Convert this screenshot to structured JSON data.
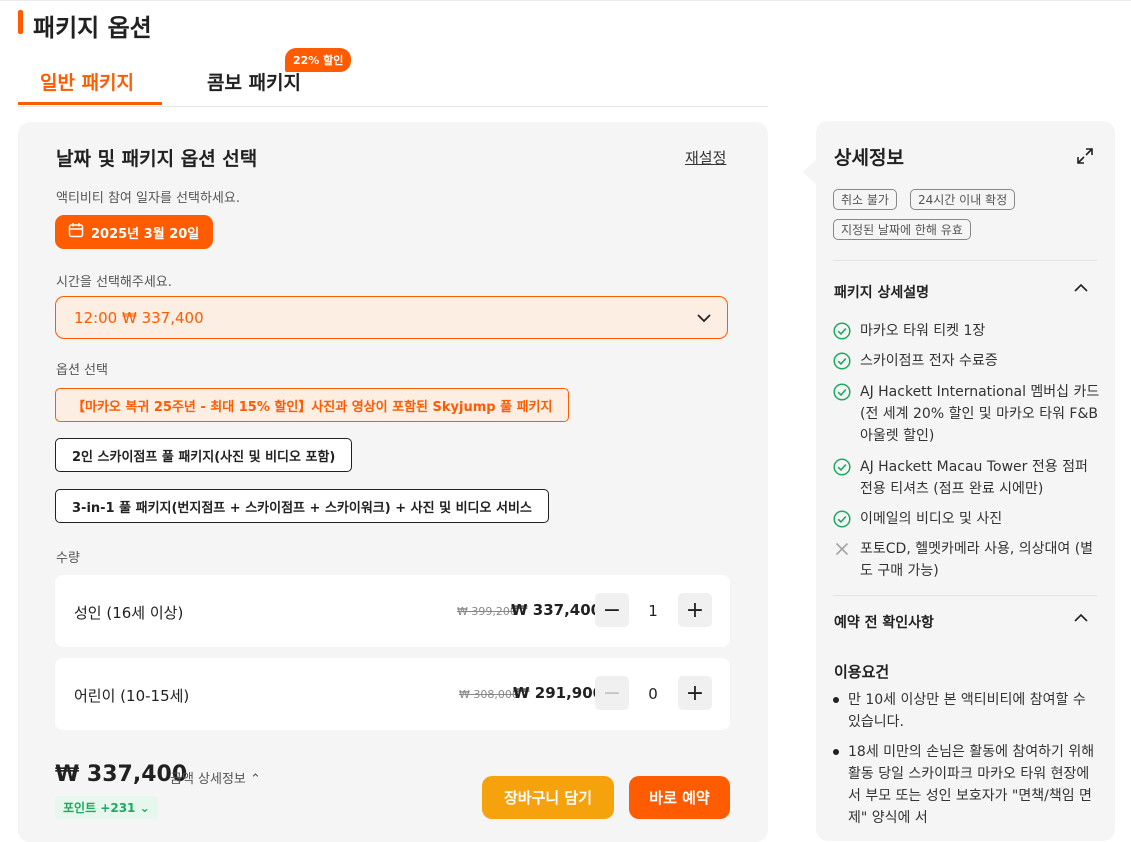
{
  "header": {
    "title": "패키지 옵션"
  },
  "tabs": [
    {
      "label": "일반 패키지",
      "active": true
    },
    {
      "label": "콤보 패키지",
      "badge": "22% 할인"
    }
  ],
  "booking": {
    "title": "날짜 및 패키지 옵션 선택",
    "reset_label": "재설정",
    "date_prompt": "액티비티 참여 일자를 선택하세요.",
    "date_value": "2025년 3월 20일",
    "time_prompt": "시간을 선택해주세요.",
    "time_value": "12:00 ₩ 337,400",
    "options_label": "옵션 선택",
    "options": [
      "【마카오 복귀 25주년 - 최대 15% 할인】사진과 영상이 포함된 Skyjump 풀 패키지",
      "2인 스카이점프 풀 패키지(사진 및 비디오 포함)",
      "3-in-1 풀 패키지(번지점프 + 스카이점프 + 스카이워크) + 사진 및 비디오 서비스"
    ],
    "selected_option_index": 0,
    "quantity_label": "수량",
    "quantities": [
      {
        "label": "성인 (16세 이상)",
        "original_price": "₩ 399,200",
        "price": "₩ 337,400",
        "count": "1",
        "minus_enabled": true
      },
      {
        "label": "어린이 (10-15세)",
        "original_price": "₩ 308,000",
        "price": "₩ 291,900",
        "count": "0",
        "minus_enabled": false
      }
    ],
    "total": "₩ 337,400",
    "total_detail_label": "금액 상세정보 ⌃",
    "points": "포인트 +231 ⌄",
    "cart_label": "장바구니 담기",
    "book_label": "바로 예약"
  },
  "details": {
    "title": "상세정보",
    "tags": [
      "취소 불가",
      "24시간 이내 확정",
      "지정된 날짜에 한해 유효"
    ],
    "package_section_title": "패키지 상세설명",
    "included": [
      {
        "text": "마카오 타워 티켓 1장",
        "included": true
      },
      {
        "text": "스카이점프 전자 수료증",
        "included": true
      },
      {
        "text": "AJ Hackett International 멤버십 카드 (전 세계 20% 할인 및 마카오 타워 F&B 아울렛 할인)",
        "included": true
      },
      {
        "text": "AJ Hackett Macau Tower 전용 점퍼 전용 티셔츠 (점프 완료 시에만)",
        "included": true
      },
      {
        "text": "이메일의 비디오 및 사진",
        "included": true
      },
      {
        "text": "포토CD, 헬멧카메라 사용, 의상대여 (별도 구매 가능)",
        "included": false
      }
    ],
    "notice_section_title": "예약 전 확인사항",
    "requirements_title": "이용요건",
    "requirements": [
      "만 10세 이상만 본 액티비티에 참여할 수 있습니다.",
      "18세 미만의 손님은 활동에 참여하기 위해 활동 당일 스카이파크 마카오 타워 현장에서 부모 또는 성인 보호자가 \"면책/책임 면제\" 양식에 서"
    ]
  },
  "colors": {
    "accent": "#ff5b00",
    "cart": "#f6a20c",
    "check": "#1ea95f"
  }
}
